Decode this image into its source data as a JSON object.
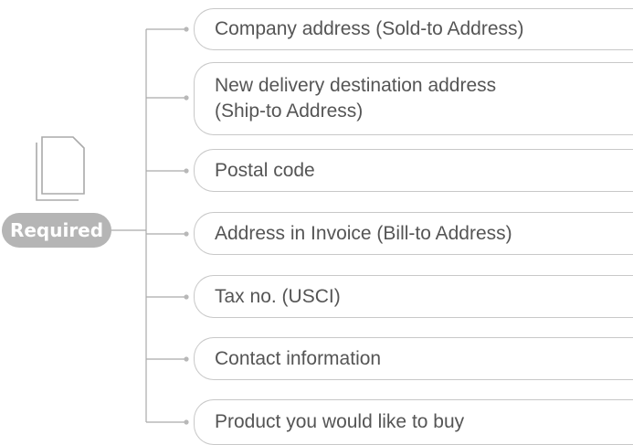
{
  "badge": {
    "label": "Required",
    "icon": "document-stack-icon"
  },
  "items": [
    {
      "label": "Company address (Sold-to Address)"
    },
    {
      "label": "New delivery destination address\n(Ship-to Address)"
    },
    {
      "label": "Postal code"
    },
    {
      "label": "Address in Invoice (Bill-to Address)"
    },
    {
      "label": "Tax no. (USCI)"
    },
    {
      "label": "Contact information"
    },
    {
      "label": "Product you would like to buy"
    }
  ],
  "colors": {
    "line": "#aaaaaa",
    "pill_border": "#c8c8c8",
    "text": "#555555",
    "badge": "#b5b5b5",
    "icon": "#aaaaaa"
  }
}
